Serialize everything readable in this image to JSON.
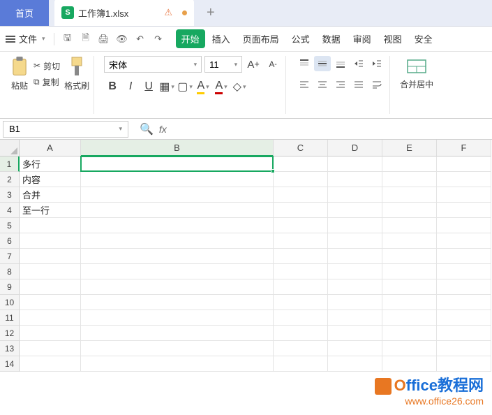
{
  "tabs": {
    "home": "首页",
    "file_name": "工作簿1.xlsx",
    "file_icon_letter": "S"
  },
  "menu": {
    "file": "文件",
    "items": [
      "开始",
      "插入",
      "页面布局",
      "公式",
      "数据",
      "审阅",
      "视图",
      "安全"
    ]
  },
  "clipboard": {
    "paste": "粘贴",
    "cut": "剪切",
    "copy": "复制",
    "format_painter": "格式刷"
  },
  "font": {
    "name": "宋体",
    "size": "11",
    "bold": "B",
    "italic": "I",
    "underline": "U",
    "increase": "A",
    "decrease": "A"
  },
  "merge": {
    "label": "合并居中"
  },
  "namebox": {
    "value": "B1"
  },
  "formula": {
    "fx": "fx",
    "value": ""
  },
  "columns": [
    "A",
    "B",
    "C",
    "D",
    "E",
    "F"
  ],
  "rows": [
    "1",
    "2",
    "3",
    "4",
    "5",
    "6",
    "7",
    "8",
    "9",
    "10",
    "11",
    "12",
    "13",
    "14"
  ],
  "cells": {
    "A1": "多行",
    "A2": "内容",
    "A3": "合并",
    "A4": "至一行"
  },
  "selected_cell": "B1",
  "watermark": {
    "title_prefix": "O",
    "title_rest": "ffice教程网",
    "url": "www.office26.com"
  }
}
